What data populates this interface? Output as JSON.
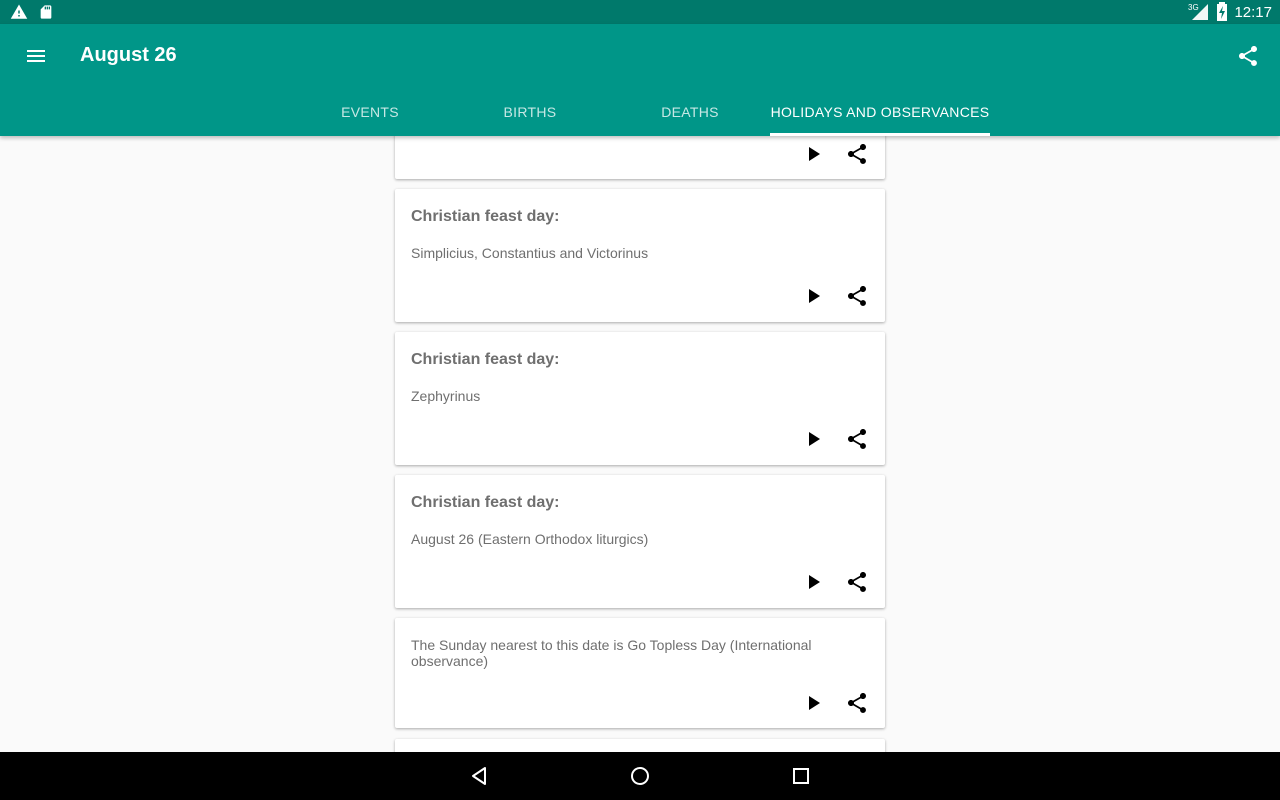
{
  "status_bar": {
    "time": "12:17",
    "network": "3G",
    "left_icons": [
      "warning-icon",
      "sd-card-icon"
    ],
    "right_icons": [
      "signal-icon",
      "battery-icon"
    ]
  },
  "header": {
    "title": "August 26",
    "menu_icon": "menu-icon",
    "share_icon": "share-icon",
    "background": "#009688",
    "status_background": "#00796b"
  },
  "tabs": [
    {
      "label": "EVENTS",
      "active": false
    },
    {
      "label": "BIRTHS",
      "active": false
    },
    {
      "label": "DEATHS",
      "active": false
    },
    {
      "label": "HOLIDAYS AND OBSERVANCES",
      "active": true
    }
  ],
  "cards": [
    {
      "title": "",
      "body": ""
    },
    {
      "title": "Christian feast day:",
      "body": "Simplicius, Constantius and Victorinus"
    },
    {
      "title": "Christian feast day:",
      "body": "Zephyrinus"
    },
    {
      "title": "Christian feast day:",
      "body": "August 26 (Eastern Orthodox liturgics)"
    },
    {
      "title": "",
      "body": "The Sunday nearest to this date is Go Topless Day (International observance)"
    },
    {
      "title": "",
      "body": ""
    }
  ],
  "card_actions": [
    "play-icon",
    "share-icon"
  ],
  "nav_bar": [
    "back-icon",
    "home-icon",
    "recents-icon"
  ]
}
